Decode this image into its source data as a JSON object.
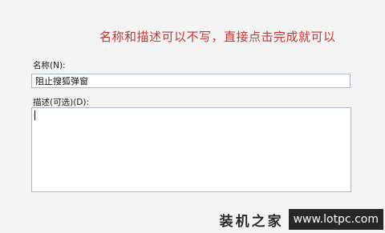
{
  "annotation": {
    "text": "名称和描述可以不写，直接点击完成就可以",
    "color": "#c8322f"
  },
  "form": {
    "name_label": "名称(N):",
    "name_value": "阻止搜狐弹窗",
    "desc_label": "描述(可选)(D):",
    "desc_value": ""
  },
  "watermark": {
    "site_name": "装机之家",
    "url": "www.lotpc.com"
  }
}
